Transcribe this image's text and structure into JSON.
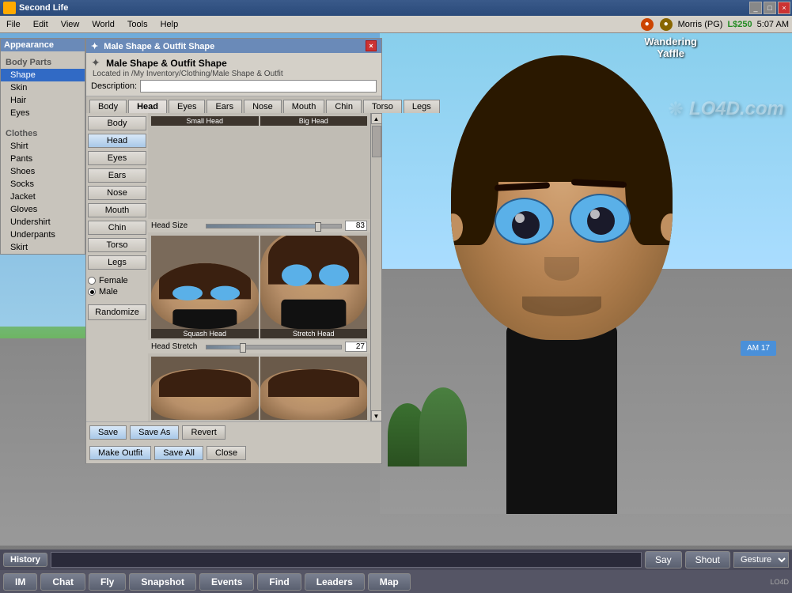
{
  "window": {
    "title": "Second Life",
    "titleIcon": "SL"
  },
  "menubar": {
    "items": [
      "File",
      "Edit",
      "View",
      "World",
      "Tools",
      "Help"
    ],
    "user": "Morris (PG)",
    "balance": "L$250",
    "clock": "5:07 AM"
  },
  "appearance": {
    "title": "Appearance",
    "bodyParts": {
      "label": "Body Parts",
      "items": [
        "Shape",
        "Skin",
        "Hair",
        "Eyes"
      ]
    },
    "clothes": {
      "label": "Clothes",
      "items": [
        "Shirt",
        "Pants",
        "Shoes",
        "Socks",
        "Jacket",
        "Gloves",
        "Undershirt",
        "Underpants",
        "Skirt"
      ]
    }
  },
  "shapePanel": {
    "titleIcon": "✦",
    "title": "Male Shape & Outfit Shape",
    "location": "Located in /My Inventory/Clothing/Male Shape & Outfit",
    "descriptionLabel": "Description:",
    "descriptionValue": "",
    "tabs": [
      "Body",
      "Head",
      "Eyes",
      "Ears",
      "Nose",
      "Mouth",
      "Chin",
      "Torso",
      "Legs"
    ],
    "activeTab": "Head",
    "previews": [
      {
        "label": "Small Head"
      },
      {
        "label": "Big Head"
      },
      {
        "label": "Squash Head"
      },
      {
        "label": "Stretch Head"
      },
      {
        "label": ""
      },
      {
        "label": ""
      }
    ],
    "sliders": [
      {
        "label": "Head Size",
        "value": "83",
        "pct": 83
      },
      {
        "label": "Head Stretch",
        "value": "27",
        "pct": 27
      }
    ],
    "gender": {
      "options": [
        "Female",
        "Male"
      ],
      "selected": "Male"
    },
    "randomizeBtn": "Randomize",
    "bottomBtns": [
      "Save",
      "Save As",
      "Revert"
    ],
    "footerBtns": [
      "Make Outfit",
      "Save All",
      "Close"
    ]
  },
  "gameworld": {
    "playerName": "Wandering\nYaffle",
    "watermark": "LO4D.com"
  },
  "bottomBar": {
    "topRow": {
      "historyLabel": "History",
      "chatInput": "",
      "chatPlaceholder": "",
      "sayBtn": "Say",
      "shoutBtn": "Shout",
      "gestureLabel": "Gesture"
    },
    "bottomRow": {
      "imBtn": "IM",
      "chatBtn": "Chat",
      "flyBtn": "Fly",
      "snapshotBtn": "Snapshot",
      "eventsBtn": "Events",
      "findBtn": "Find",
      "leadersBtn": "Leaders",
      "mapBtn": "Map"
    }
  }
}
